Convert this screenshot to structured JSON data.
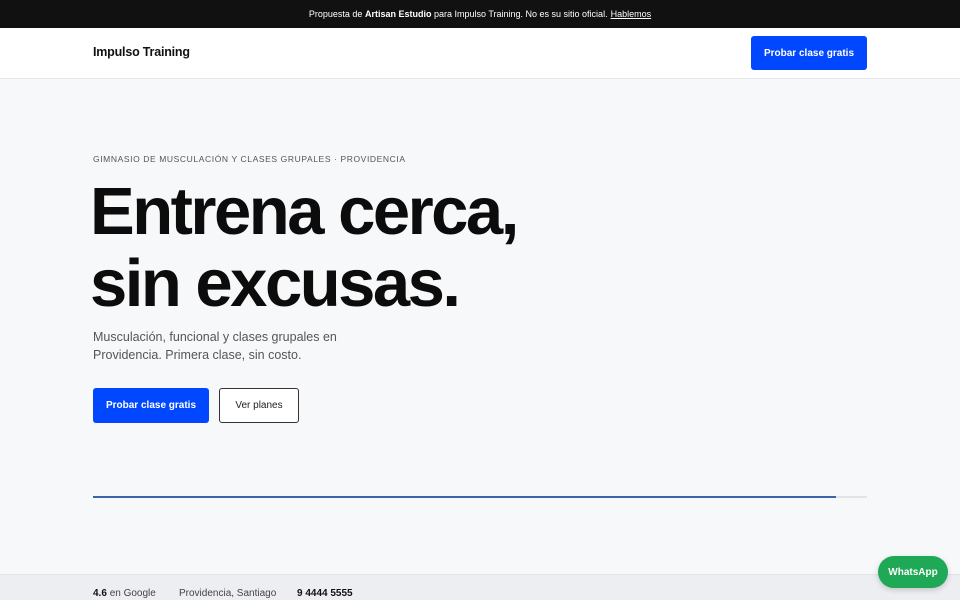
{
  "topbar": {
    "prefix": "Propuesta de",
    "studio": "Artisan Estudio",
    "middle": "para Impulso Training. No es su sitio oficial.",
    "link": "Hablemos"
  },
  "header": {
    "brand": "Impulso Training",
    "cta": "Probar clase gratis"
  },
  "hero": {
    "eyebrow": "GIMNASIO DE MUSCULACIÓN Y CLASES GRUPALES · PROVIDENCIA",
    "headline_line1": "Entrena cerca,",
    "headline_line2": "sin excusas.",
    "subtext": "Musculación, funcional y clases grupales en Providencia. Primera clase, sin costo.",
    "primary_cta": "Probar clase gratis",
    "secondary_cta": "Ver planes"
  },
  "progress": {
    "fraction": 0.96
  },
  "stats": {
    "rating": "4.6",
    "rating_suffix": "en Google",
    "location": "Providencia, Santiago",
    "phone": "9 4444 5555"
  },
  "whatsapp": {
    "label": "WhatsApp"
  },
  "colors": {
    "accent": "#0047ff",
    "whatsapp": "#1fa855",
    "topbar": "#111111"
  }
}
